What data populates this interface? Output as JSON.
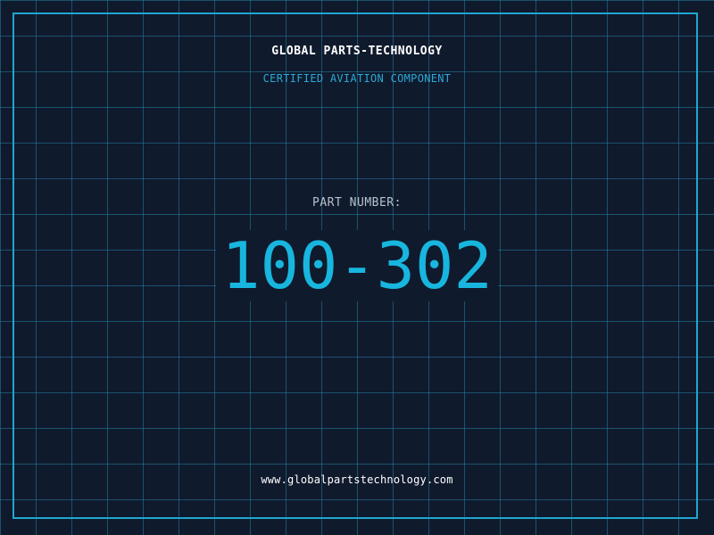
{
  "brand": {
    "title": "GLOBAL PARTS-TECHNOLOGY",
    "subtitle": "CERTIFIED AVIATION COMPONENT"
  },
  "part": {
    "label": "PART NUMBER:",
    "number": "100-302"
  },
  "footer": {
    "website": "www.globalpartstechnology.com"
  },
  "colors": {
    "background": "#101a2d",
    "grid": "#2280a0",
    "accent": "#18b6de",
    "title_text": "#ffffff",
    "label_text": "#b7c1cc"
  }
}
